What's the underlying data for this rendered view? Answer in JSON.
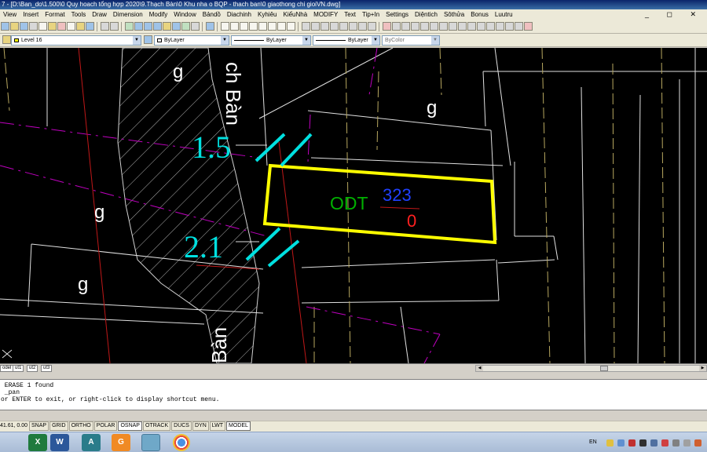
{
  "window": {
    "title": "7 - [D:\\Ban_do\\1.500\\0 Quy hoach tổng hợp 2020\\9.Thạch Bàn\\0 Khu nha o BQP - thach ban\\0 giaothong chi gioiVN.dwg]",
    "controls": "_ ◻ ✕"
  },
  "menu": [
    "View",
    "Insert",
    "Format",
    "Tools",
    "Draw",
    "Dimension",
    "Modify",
    "Window",
    "Bảndồ",
    "Diachinh",
    "Kyhiêu",
    "KiểuNhà",
    "MODIFY",
    "Text",
    "Tip+In",
    "Settings",
    "Diệntich",
    "Sôthửa",
    "Bonus",
    "Luutru"
  ],
  "toolbar2": {
    "layer": "Level 16",
    "color": "ByLayer",
    "linetype": "ByLayer",
    "lineweight": "ByLayer",
    "plotstyle": "ByColor"
  },
  "drawing": {
    "street_label_top": "ch Bàn",
    "street_label_bottom": "Bàn",
    "land_label_1": "g",
    "land_label_2": "g",
    "land_label_3": "g",
    "land_label_4": "g",
    "dimension_top": "1.5",
    "dimension_bottom": "2.1",
    "parcel_type": "ODT",
    "parcel_number": "323",
    "parcel_area": "0"
  },
  "layout_tabs": [
    "odel",
    "ut1",
    "ut2",
    "ut3"
  ],
  "command": {
    "line1": " ERASE 1 found",
    "line2": " _pan",
    "line3": "or ENTER to exit, or right-click to display shortcut menu."
  },
  "status": {
    "coords": "41.61, 0.00",
    "buttons": [
      "SNAP",
      "GRID",
      "ORTHO",
      "POLAR",
      "OSNAP",
      "OTRACK",
      "DUCS",
      "DYN",
      "LWT",
      "MODEL"
    ],
    "active": [
      "OSNAP",
      "MODEL"
    ]
  },
  "taskbar": {
    "apps": [
      {
        "name": "excel-app-icon",
        "letter": "X",
        "color": "#1f7a3d"
      },
      {
        "name": "word-app-icon",
        "letter": "W",
        "color": "#2b579a"
      },
      {
        "name": "autocad-app-icon",
        "letter": "A",
        "color": "#2a7c8a"
      },
      {
        "name": "g-app-icon",
        "letter": "G",
        "color": "#f08a24"
      },
      {
        "name": "notepad-app-icon",
        "letter": "",
        "color": "#6fa8c8"
      },
      {
        "name": "chrome-app-icon",
        "letter": "",
        "color": "#e8e8e8"
      }
    ],
    "language": "EN"
  },
  "colors": {
    "drawing_background": "#000000",
    "parcel_outline": "#ffff00",
    "dimension_text": "#00e0e0",
    "parcel_type_text": "#00b000",
    "parcel_number_text": "#2040ff",
    "parcel_area_text": "#ff2020",
    "boundary_magenta": "#c000c0",
    "boundary_red": "#c01818",
    "boundary_khaki": "#b8a860",
    "linework_white": "#e0e0e0"
  }
}
